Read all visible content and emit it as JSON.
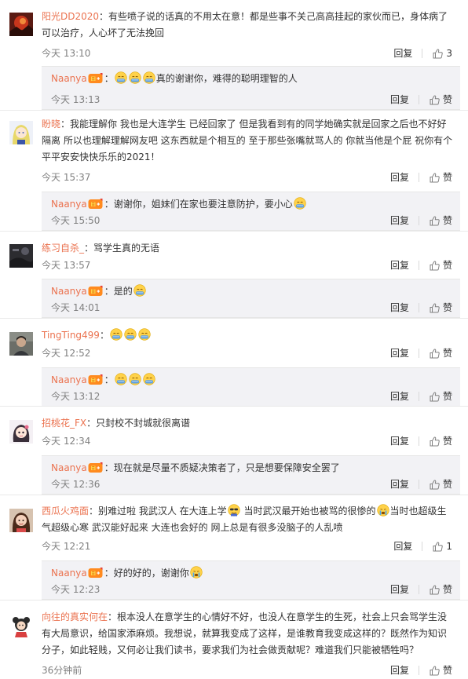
{
  "ui": {
    "reply_label": "回复",
    "like_label": "赞"
  },
  "comments": [
    {
      "username": "阳光DD2020",
      "avatar": "avatar-red-landscape",
      "text": "有些喷子说的话真的不用太在意！都是些事不关己高高挂起的家伙而已，身体病了可以治疗，人心坏了无法挽回",
      "time": "今天 13:10",
      "likes": "3",
      "reply": {
        "username": "Naanya",
        "badge": "fan-badge-icon",
        "segments": [
          {
            "type": "emoji",
            "name": "face-palm-emoji"
          },
          {
            "type": "emoji",
            "name": "face-palm-emoji"
          },
          {
            "type": "emoji",
            "name": "face-palm-emoji"
          },
          {
            "type": "text",
            "value": "真的谢谢你，难得的聪明理智的人"
          }
        ],
        "time": "今天 13:13",
        "likes": "赞"
      }
    },
    {
      "username": "盼晓",
      "avatar": "avatar-anime-girl",
      "text": "我能理解你 我也是大连学生 已经回家了 但是我看到有的同学她确实就是回家之后也不好好隔离 所以也理解理解网友吧 这东西就是个相互的 至于那些张嘴就骂人的 你就当他是个屁 祝你有个平平安安快快乐乐的2021！",
      "time": "今天 15:37",
      "likes": "赞",
      "reply": {
        "username": "Naanya",
        "badge": "fan-badge-icon",
        "segments": [
          {
            "type": "text",
            "value": "谢谢你，姐妹们在家也要注意防护，要小心"
          },
          {
            "type": "emoji",
            "name": "face-palm-emoji"
          }
        ],
        "time": "今天 15:50",
        "likes": "赞"
      }
    },
    {
      "username": "练习自杀_",
      "avatar": "avatar-dark-photo",
      "text": "骂学生真的无语",
      "time": "今天 13:57",
      "likes": "赞",
      "reply": {
        "username": "Naanya",
        "badge": "fan-badge-icon",
        "segments": [
          {
            "type": "text",
            "value": "是的"
          },
          {
            "type": "emoji",
            "name": "face-palm-emoji"
          }
        ],
        "time": "今天 14:01",
        "likes": "赞"
      }
    },
    {
      "username": "TingTing499",
      "avatar": "avatar-person-photo",
      "text": "",
      "segments": [
        {
          "type": "emoji",
          "name": "face-palm-emoji"
        },
        {
          "type": "emoji",
          "name": "face-palm-emoji"
        },
        {
          "type": "emoji",
          "name": "face-palm-emoji"
        }
      ],
      "time": "今天 12:52",
      "likes": "赞",
      "reply": {
        "username": "Naanya",
        "badge": "fan-badge-icon",
        "segments": [
          {
            "type": "emoji",
            "name": "face-palm-emoji"
          },
          {
            "type": "emoji",
            "name": "face-palm-emoji"
          },
          {
            "type": "emoji",
            "name": "face-palm-emoji"
          }
        ],
        "time": "今天 13:12",
        "likes": "赞"
      }
    },
    {
      "username": "招桃花_FX",
      "avatar": "avatar-cartoon-girl",
      "text": "只封校不封城就很离谱",
      "time": "今天 12:34",
      "likes": "赞",
      "reply": {
        "username": "Naanya",
        "badge": "fan-badge-icon",
        "segments": [
          {
            "type": "text",
            "value": "现在就是尽量不质疑决策者了，只是想要保障安全罢了"
          }
        ],
        "time": "今天 12:36",
        "likes": "赞"
      }
    },
    {
      "username": "西瓜火鸡面",
      "avatar": "avatar-girl-photo",
      "text": "",
      "segments": [
        {
          "type": "text",
          "value": "别难过啦 我武汉人 在大连上学"
        },
        {
          "type": "emoji",
          "name": "cool-face-emoji"
        },
        {
          "type": "text",
          "value": " 当时武汉最开始也被骂的很惨的"
        },
        {
          "type": "emoji",
          "name": "crying-face-emoji"
        },
        {
          "type": "text",
          "value": "当时也超级生气超级心寒 武汉能好起来 大连也会好的 网上总是有很多没脑子的人乱喷"
        }
      ],
      "time": "今天 12:21",
      "likes": "1",
      "reply": {
        "username": "Naanya",
        "badge": "fan-badge-icon",
        "segments": [
          {
            "type": "text",
            "value": "好的好的，谢谢你"
          },
          {
            "type": "emoji",
            "name": "crying-face-emoji"
          }
        ],
        "time": "今天 12:23",
        "likes": "赞"
      }
    },
    {
      "username": "向往的真实何在",
      "avatar": "avatar-cartoon-bear",
      "text": "根本没人在意学生的心情好不好，也没人在意学生的生死，社会上只会骂学生没有大局意识，给国家添麻烦。我想说，就算我变成了这样，是谁教育我变成这样的？既然作为知识分子，如此轻贱，又何必让我们读书，要求我们为社会做贡献呢？难道我们只能被牺牲吗？",
      "time": "36分钟前",
      "likes": "赞"
    }
  ]
}
